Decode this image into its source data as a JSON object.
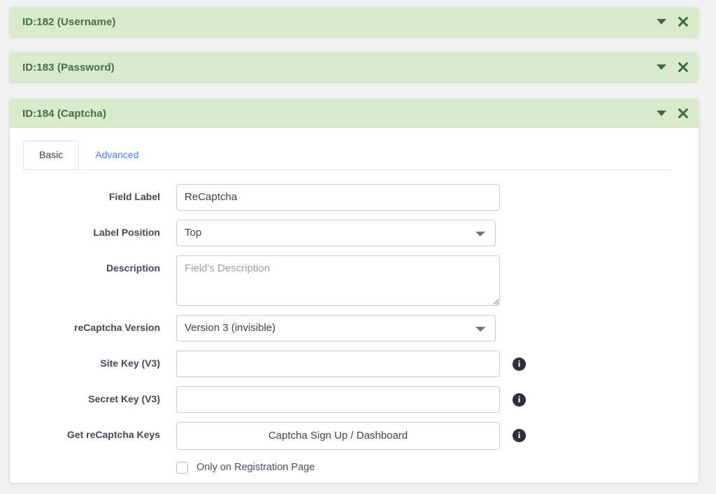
{
  "panels": [
    {
      "title": "ID:182 (Username)",
      "caret_icon": "chevron-down-icon",
      "close_icon": "close-icon"
    },
    {
      "title": "ID:183 (Password)",
      "caret_icon": "chevron-down-icon",
      "close_icon": "close-icon"
    },
    {
      "title": "ID:184 (Captcha)",
      "caret_icon": "chevron-down-icon",
      "close_icon": "close-icon"
    }
  ],
  "tabs": [
    {
      "label": "Basic",
      "active": true
    },
    {
      "label": "Advanced",
      "active": false
    }
  ],
  "form": {
    "field_label": {
      "label": "Field Label",
      "value": "ReCaptcha"
    },
    "label_position": {
      "label": "Label Position",
      "value": "Top"
    },
    "description": {
      "label": "Description",
      "value": "",
      "placeholder": "Field's Description"
    },
    "recaptcha_version": {
      "label": "reCaptcha Version",
      "value": "Version 3 (invisible)"
    },
    "site_key": {
      "label": "Site Key (V3)",
      "value": "",
      "placeholder": "",
      "info_icon": "info-icon"
    },
    "secret_key": {
      "label": "Secret Key (V3)",
      "value": "",
      "placeholder": "",
      "info_icon": "info-icon"
    },
    "get_keys": {
      "label": "Get reCaptcha Keys",
      "button_label": "Captcha Sign Up / Dashboard",
      "info_icon": "info-icon"
    },
    "only_registration": {
      "label": "Only on Registration Page",
      "checked": false
    }
  },
  "colors": {
    "header_green": "#d8e9cc",
    "header_text": "#437043",
    "page_bg": "#f0f0f0",
    "link_blue": "#4a7cf3",
    "info_dark": "#2c3137"
  }
}
